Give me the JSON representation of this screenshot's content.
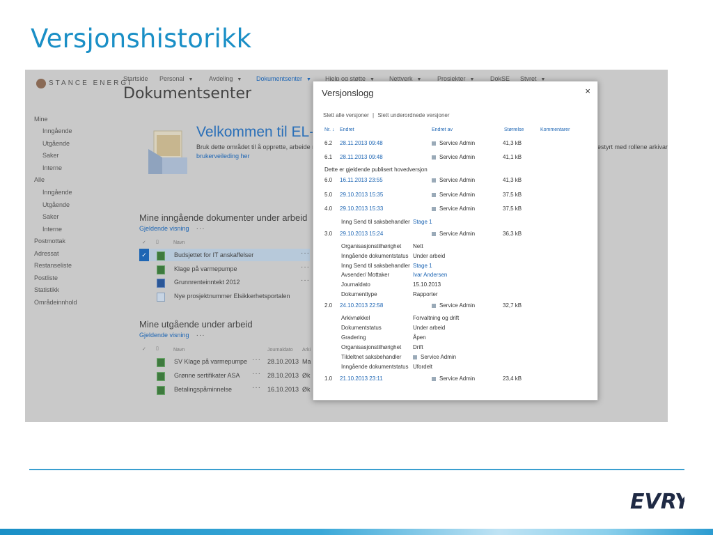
{
  "slide": {
    "title": "Versjonshistorikk"
  },
  "brand": {
    "logo_text": "STANCE ENERGI",
    "footer_logo": "EVRY",
    "accent": "#1a8fc6"
  },
  "sharepoint": {
    "topnav": [
      {
        "label": "Startside",
        "caret": false
      },
      {
        "label": "Personal",
        "caret": true
      },
      {
        "label": "Avdeling",
        "caret": true
      },
      {
        "label": "Dokumentsenter",
        "caret": true,
        "active": true
      },
      {
        "label": "Hjelp og støtte",
        "caret": true
      },
      {
        "label": "Nettverk",
        "caret": true
      },
      {
        "label": "Prosjekter",
        "caret": true
      },
      {
        "label": "DokSE",
        "caret": false
      },
      {
        "label": "Styret",
        "caret": true
      }
    ],
    "page_title": "Dokumentsenter",
    "leftnav": {
      "mine": "Mine",
      "mine_items": [
        "Inngående",
        "Utgående",
        "Saker",
        "Interne"
      ],
      "alle": "Alle",
      "alle_items": [
        "Inngående",
        "Utgående",
        "Saker",
        "Interne"
      ],
      "others": [
        "Postmottak",
        "Adressat",
        "Restanseliste",
        "Postliste",
        "Statistikk",
        "Områdeinnhold"
      ]
    },
    "welcome": {
      "title": "Velkommen til EL-ar",
      "text": "Bruk dette området til å opprette, arbeide m",
      "link": "brukerveileding her",
      "right_text": "ollestyrt med rollene arkivar"
    },
    "incoming": {
      "title": "Mine inngående dokumenter under arbeid",
      "view": "Gjeldende visning",
      "col_name": "Navn",
      "rows": [
        "Budsjettet for IT anskaffelser",
        "Klage på varmepumpe",
        "Grunnrenteinntekt 2012",
        "Nye prosjektnummer Elsikkerhetsportalen"
      ]
    },
    "outgoing": {
      "title": "Mine utgående under arbeid",
      "view": "Gjeldende visning",
      "col_name": "Navn",
      "col_date": "Journaldato",
      "col_arch": "Arki",
      "rows": [
        {
          "name": "SV Klage på varmepumpe",
          "date": "28.10.2013",
          "cut": "Ma"
        },
        {
          "name": "Grønne sertifikater ASA",
          "date": "28.10.2013",
          "cut": "Øk"
        },
        {
          "name": "Betalingspåminnelse",
          "date": "16.10.2013",
          "cut": "Øk"
        }
      ]
    }
  },
  "dialog": {
    "title": "Versjonslogg",
    "close": "×",
    "actions": {
      "delete_all": "Slett alle versjoner",
      "sep": "|",
      "delete_minor": "Slett underordnede versjoner"
    },
    "headers": {
      "nr": "Nr. ↓",
      "changed": "Endret",
      "changed_by": "Endret av",
      "size": "Størrelse",
      "comment": "Kommentarer"
    },
    "current_note": "Dette er gjeldende publisert hovedversjon",
    "versions": [
      {
        "nr": "6.2",
        "date": "28.11.2013 09:48",
        "by": "Service Admin",
        "size": "41,3 kB"
      },
      {
        "nr": "6.1",
        "date": "28.11.2013 09:48",
        "by": "Service Admin",
        "size": "41,1 kB"
      },
      {
        "nr": "6.0",
        "date": "16.11.2013 23:55",
        "by": "Service Admin",
        "size": "41,3 kB"
      },
      {
        "nr": "5.0",
        "date": "29.10.2013 15:35",
        "by": "Service Admin",
        "size": "37,5 kB"
      },
      {
        "nr": "4.0",
        "date": "29.10.2013 15:33",
        "by": "Service Admin",
        "size": "37,5 kB"
      },
      {
        "nr": "3.0",
        "date": "29.10.2013 15:24",
        "by": "Service Admin",
        "size": "36,3 kB"
      },
      {
        "nr": "2.0",
        "date": "24.10.2013 22:58",
        "by": "Service Admin",
        "size": "32,7 kB"
      },
      {
        "nr": "1.0",
        "date": "21.10.2013 23:11",
        "by": "Service Admin",
        "size": "23,4 kB"
      }
    ],
    "v4_detail": {
      "k": "Inng Send til saksbehandler",
      "v": "Stage 1"
    },
    "v3_props": [
      {
        "k": "Organisasjonstilhørighet",
        "v": "Nett"
      },
      {
        "k": "Inngående dokumentstatus",
        "v": "Under arbeid"
      },
      {
        "k": "Inng Send til saksbehandler",
        "v": "Stage 1"
      },
      {
        "k": "Avsender/ Mottaker",
        "v": "Ivar Andersen"
      },
      {
        "k": "Journaldato",
        "v": "15.10.2013"
      },
      {
        "k": "Dokumenttype",
        "v": "Rapporter"
      }
    ],
    "v2_props": [
      {
        "k": "Arkivnøkkel",
        "v": "Forvaltning og drift"
      },
      {
        "k": "Dokumentstatus",
        "v": "Under arbeid"
      },
      {
        "k": "Gradering",
        "v": "Åpen"
      },
      {
        "k": "Organisasjonstilhørighet",
        "v": "Drift"
      },
      {
        "k": "Tildeltnet saksbehandler",
        "v": "Service Admin"
      },
      {
        "k": "Inngående dokumentstatus",
        "v": "Ufordelt"
      }
    ]
  }
}
